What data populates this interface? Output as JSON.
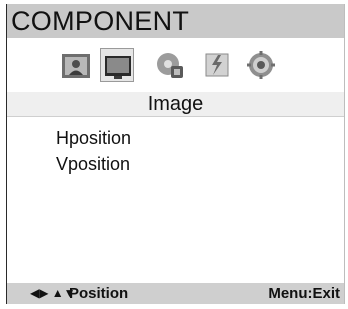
{
  "header": {
    "title": "COMPONENT"
  },
  "icons": [
    {
      "name": "picture-icon",
      "selected": false
    },
    {
      "name": "monitor-icon",
      "selected": true
    },
    {
      "name": "sound-icon",
      "selected": false
    },
    {
      "name": "function-icon",
      "selected": false
    },
    {
      "name": "settings-icon",
      "selected": false
    }
  ],
  "page": {
    "title": "Image"
  },
  "menu": {
    "items": [
      "Hposition",
      "Vposition"
    ]
  },
  "footer": {
    "nav_arrows": "◆◆",
    "nav_label": "Position",
    "exit_label": "Menu:Exit"
  },
  "colors": {
    "title_bar": "#c9c9c9",
    "page_title_bar": "#efefef",
    "footer_bar": "#cfcfcf"
  }
}
